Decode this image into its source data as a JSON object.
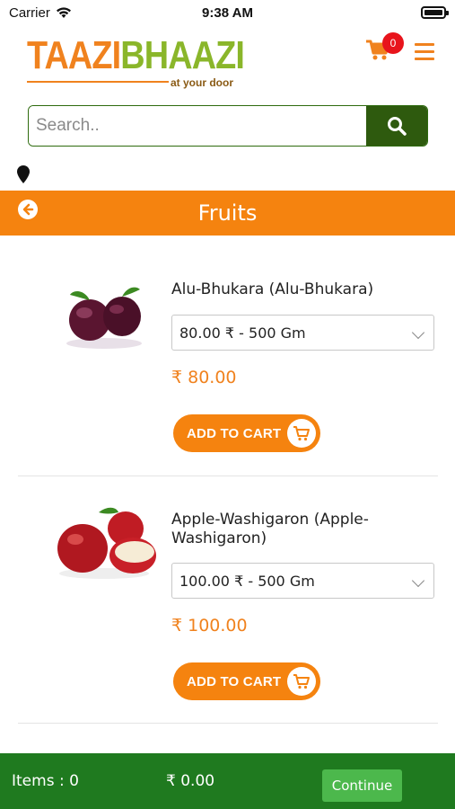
{
  "status_bar": {
    "carrier": "Carrier",
    "time": "9:38 AM",
    "icons": [
      "wifi-icon",
      "battery-icon"
    ]
  },
  "header": {
    "logo_part1": "TAAZI",
    "logo_part2": "BHAAZI",
    "logo_tagline": "at your door",
    "cart_count": "0",
    "icons": [
      "cart-icon",
      "menu-icon"
    ]
  },
  "search": {
    "placeholder": "Search..",
    "icon": "search-icon"
  },
  "location": {
    "icon": "location-pin-icon"
  },
  "page": {
    "title": "Fruits",
    "back_icon": "back-arrow-icon"
  },
  "products": [
    {
      "name": "Alu-Bhukara (Alu-Bhukara)",
      "variant": "80.00 ₹ - 500 Gm",
      "price": "₹ 80.00",
      "add_label": "ADD TO CART",
      "image": "plum-image"
    },
    {
      "name": "Apple-Washigaron (Apple-Washigaron)",
      "name_line1": "Apple-Washigaron (Apple-",
      "name_line2": "Washigaron)",
      "variant": "100.00 ₹ - 500 Gm",
      "price": "₹ 100.00",
      "add_label": "ADD TO CART",
      "image": "apple-image"
    }
  ],
  "bottom_bar": {
    "items_label": "Items : 0",
    "total": "₹ 0.00",
    "continue_label": "Continue"
  },
  "colors": {
    "primary_orange": "#f5830f",
    "dark_green": "#2e5a0e",
    "bottom_green": "#1f7a1f",
    "button_green": "#4cb84c",
    "badge_red": "#e8141c",
    "logo_green": "#8ab62a"
  }
}
